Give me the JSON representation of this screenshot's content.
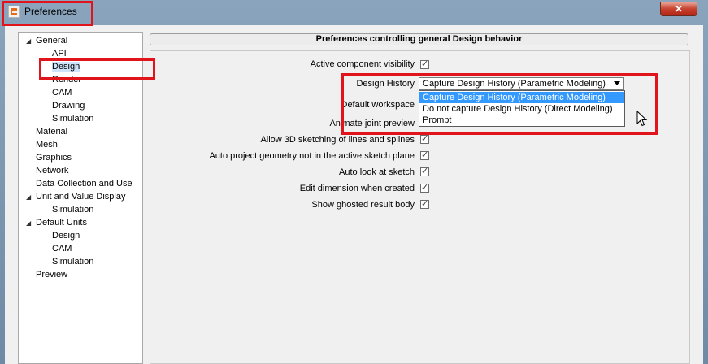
{
  "window": {
    "title": "Preferences",
    "close_symbol": "✕"
  },
  "tree": {
    "items": [
      {
        "label": "General",
        "expanded": true
      },
      {
        "label": "API"
      },
      {
        "label": "Design",
        "selected": true
      },
      {
        "label": "Render"
      },
      {
        "label": "CAM"
      },
      {
        "label": "Drawing"
      },
      {
        "label": "Simulation"
      },
      {
        "label": "Material"
      },
      {
        "label": "Mesh"
      },
      {
        "label": "Graphics"
      },
      {
        "label": "Network"
      },
      {
        "label": "Data Collection and Use"
      },
      {
        "label": "Unit and Value Display",
        "expanded": true
      },
      {
        "label": "Simulation"
      },
      {
        "label": "Default Units",
        "expanded": true
      },
      {
        "label": "Design"
      },
      {
        "label": "CAM"
      },
      {
        "label": "Simulation"
      },
      {
        "label": "Preview"
      }
    ]
  },
  "panel": {
    "title": "Preferences controlling general Design behavior",
    "settings": [
      {
        "label": "Active component visibility",
        "checked": true
      },
      {
        "label": "Design History",
        "type": "combo"
      },
      {
        "label": "Default workspace"
      },
      {
        "label": "Animate joint preview"
      },
      {
        "label": "Allow 3D sketching of lines and splines",
        "checked": true
      },
      {
        "label": "Auto project geometry not in the active sketch plane",
        "checked": true
      },
      {
        "label": "Auto look at sketch",
        "checked": true
      },
      {
        "label": "Edit dimension when created",
        "checked": true
      },
      {
        "label": "Show ghosted result body",
        "checked": true
      }
    ]
  },
  "design_history": {
    "selected": "Capture Design History (Parametric Modeling)",
    "options": [
      "Capture Design History (Parametric Modeling)",
      "Do not capture Design History (Direct Modeling)",
      "Prompt"
    ]
  },
  "colors": {
    "highlight": "#e0141a",
    "selection": "#3399ff"
  }
}
